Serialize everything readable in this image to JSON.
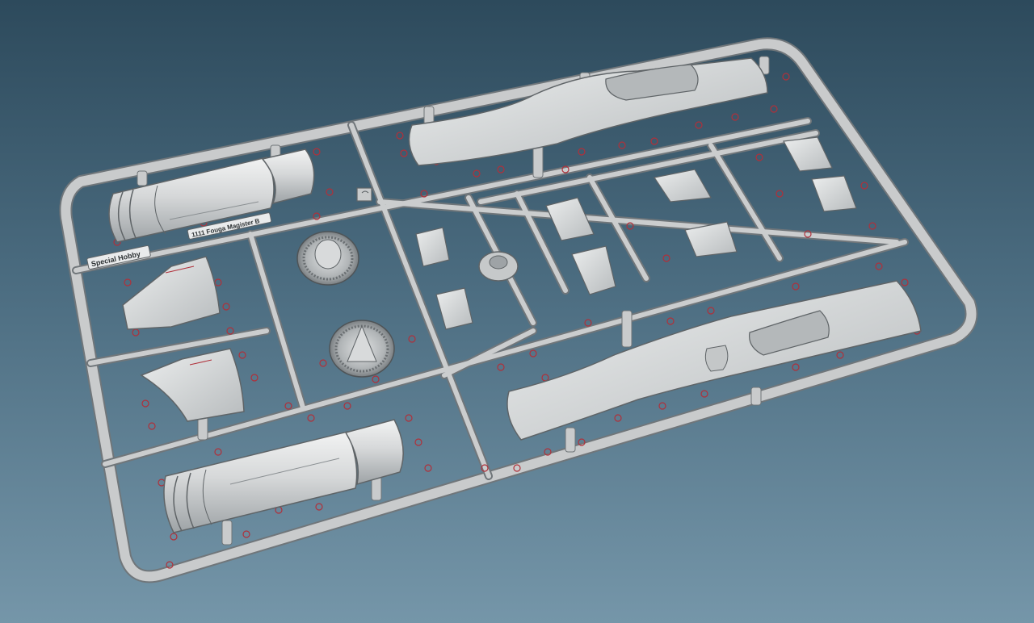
{
  "scene": {
    "subject": "plastic model kit sprue",
    "background_top": "#2d4a5c",
    "background_bottom": "#7596a9",
    "plastic_color": "#c9cbcc",
    "plastic_edge": "#6f7477",
    "marker_color": "#b0303a"
  },
  "sprue_labels": {
    "brand": "Special Hobby",
    "part_code": "1111 Fouga Magister B"
  }
}
